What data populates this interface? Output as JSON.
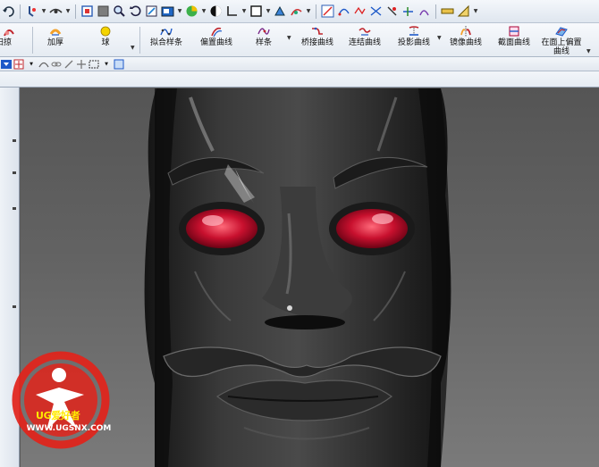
{
  "toolbar_icons": [
    "undo-icon",
    "snap-icon",
    "view-icon",
    "select-icon",
    "shaded-icon",
    "zoom-icon",
    "rotate-icon",
    "fit-icon",
    "render-icon",
    "color-sphere-icon",
    "display-icon",
    "wcs-icon",
    "layer-box-icon",
    "move-icon",
    "sweep-icon",
    "curve-tools-icon",
    "analysis-icon"
  ],
  "ribbon": {
    "items": [
      {
        "label": "扫掠"
      },
      {
        "label": "加厚"
      },
      {
        "label": "球"
      },
      {
        "label": "拟合样条"
      },
      {
        "label": "偏置曲线"
      },
      {
        "label": "样条"
      },
      {
        "label": "桥接曲线"
      },
      {
        "label": "连结曲线"
      },
      {
        "label": "投影曲线"
      },
      {
        "label": "镜像曲线"
      },
      {
        "label": "截面曲线"
      },
      {
        "label": "在面上偏置",
        "label2": "曲线"
      }
    ]
  },
  "watermark": {
    "brand": "UG爱好者",
    "url": "WWW.UGSNX.COM"
  },
  "colors": {
    "viewport_top": "#555555",
    "viewport_bottom": "#7a7a7a",
    "mask": "#2a2a2a",
    "eye": "#c8102e",
    "watermark": "#e2231a"
  }
}
